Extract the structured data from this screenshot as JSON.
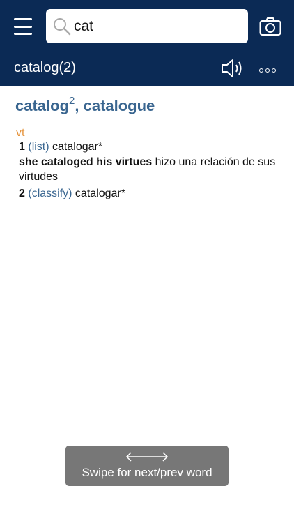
{
  "header": {
    "search_value": "cat",
    "entry_title": "catalog(2)",
    "icons": [
      "menu-icon",
      "search-icon",
      "camera-icon",
      "speaker-icon",
      "more-icon"
    ],
    "colors": {
      "bar": "#0b2a55",
      "link": "#3a6690",
      "pos": "#e5923a"
    }
  },
  "entry": {
    "headword": "catalog",
    "superscript": "2",
    "headword_variant": ", catalogue",
    "part_of_speech": "vt",
    "senses": [
      {
        "number": "1",
        "gloss": "(list)",
        "translation": "catalogar*"
      },
      {
        "number": "2",
        "gloss": "(classify)",
        "translation": "catalogar*"
      }
    ],
    "example": {
      "phrase": "she cataloged his virtues",
      "translation": "hizo una relación de sus virtudes"
    }
  },
  "toast": {
    "text": "Swipe for next/prev word"
  }
}
